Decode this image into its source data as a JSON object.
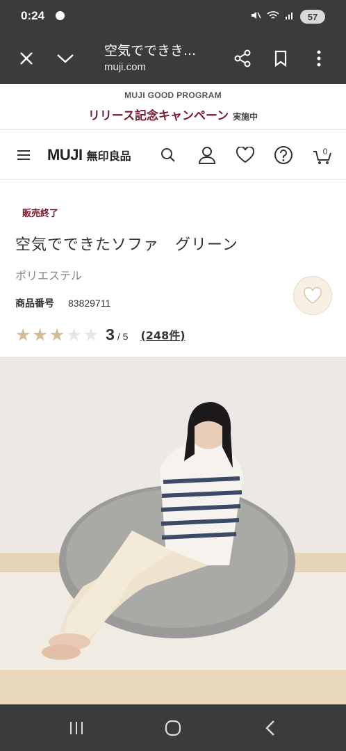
{
  "status_bar": {
    "time": "0:24",
    "battery": "57"
  },
  "browser": {
    "title": "空気でできき...",
    "url": "muji.com"
  },
  "promo": {
    "subtitle": "MUJI GOOD PROGRAM",
    "title": "リリース記念キャンペーン",
    "tag": "実施中"
  },
  "header": {
    "logo_en": "MUJI",
    "logo_jp": "無印良品",
    "cart_count": "0"
  },
  "product": {
    "status": "販売終了",
    "name": "空気でできたソファ　グリーン",
    "material": "ポリエステル",
    "code_label": "商品番号",
    "code_value": "83829711",
    "rating": 3,
    "rating_value": "3",
    "rating_max": "/ 5",
    "reviews": "(248件)"
  },
  "colors": {
    "chrome": "#3a3b3d",
    "accent": "#7a1a2f",
    "star": "#d2bd94",
    "fav_bg": "#f6efe2"
  },
  "icons": {
    "browser": [
      "close-icon",
      "chevron-down-icon",
      "share-icon",
      "bookmark-icon",
      "more-vertical-icon"
    ],
    "header": [
      "menu-icon",
      "search-icon",
      "user-icon",
      "heart-icon",
      "help-icon",
      "cart-icon"
    ],
    "nav": [
      "recent-apps-icon",
      "home-icon",
      "back-icon"
    ]
  }
}
